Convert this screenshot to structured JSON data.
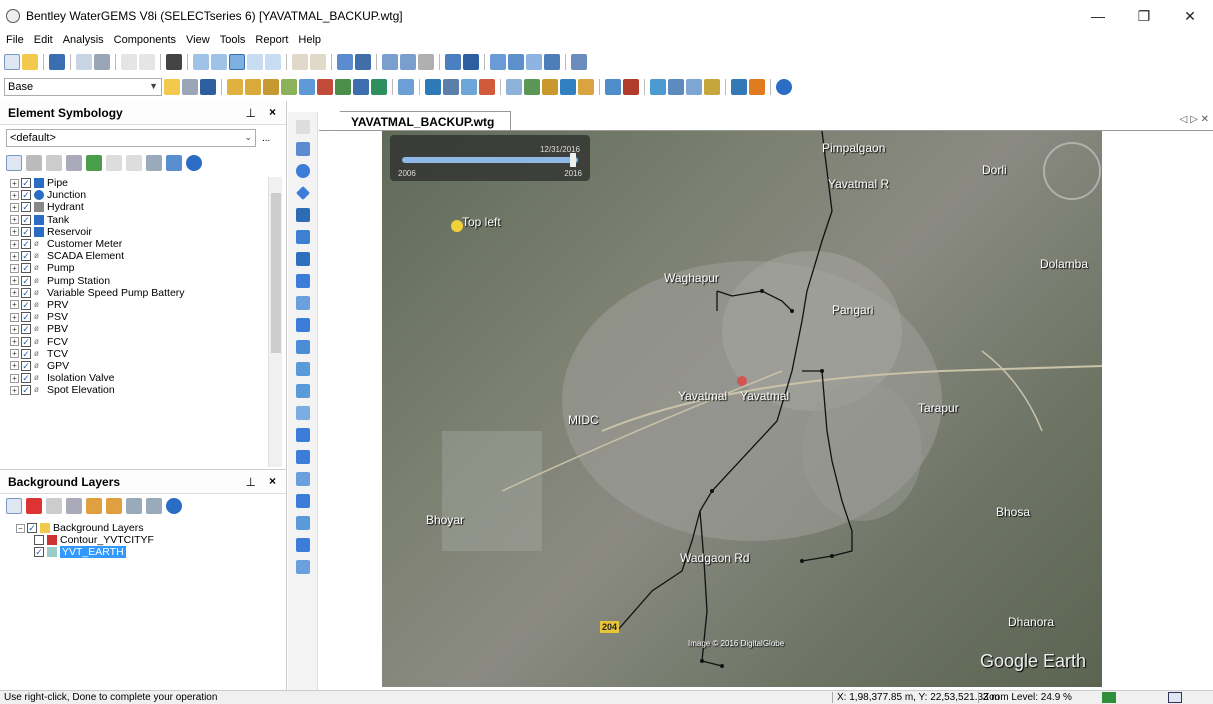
{
  "window": {
    "title": "Bentley WaterGEMS V8i (SELECTseries 6) [YAVATMAL_BACKUP.wtg]"
  },
  "menu": [
    "File",
    "Edit",
    "Analysis",
    "Components",
    "View",
    "Tools",
    "Report",
    "Help"
  ],
  "scenario_combo": {
    "value": "Base"
  },
  "element_symbology": {
    "title": "Element Symbology",
    "pin": "2",
    "close": "×",
    "dropdown_value": "<default>",
    "items": [
      {
        "label": "Pipe",
        "checked": true
      },
      {
        "label": "Junction",
        "checked": true
      },
      {
        "label": "Hydrant",
        "checked": true
      },
      {
        "label": "Tank",
        "checked": true
      },
      {
        "label": "Reservoir",
        "checked": true
      },
      {
        "label": "Customer Meter",
        "checked": true
      },
      {
        "label": "SCADA Element",
        "checked": true
      },
      {
        "label": "Pump",
        "checked": true
      },
      {
        "label": "Pump Station",
        "checked": true
      },
      {
        "label": "Variable Speed Pump Battery",
        "checked": true
      },
      {
        "label": "PRV",
        "checked": true
      },
      {
        "label": "PSV",
        "checked": true
      },
      {
        "label": "PBV",
        "checked": true
      },
      {
        "label": "FCV",
        "checked": true
      },
      {
        "label": "TCV",
        "checked": true
      },
      {
        "label": "GPV",
        "checked": true
      },
      {
        "label": "Isolation Valve",
        "checked": true
      },
      {
        "label": "Spot Elevation",
        "checked": true
      }
    ]
  },
  "background_layers": {
    "title": "Background Layers",
    "close": "×",
    "root": "Background Layers",
    "children": [
      {
        "label": "Contour_YVTCITYF",
        "checked": false
      },
      {
        "label": "YVT_EARTH",
        "checked": true,
        "selected": true
      }
    ]
  },
  "document_tab": {
    "label": "YAVATMAL_BACKUP.wtg"
  },
  "map": {
    "timeline": {
      "start": "2006",
      "end": "2016",
      "date": "12/31/2016"
    },
    "labels": [
      "Pimpalgaon",
      "Dorli",
      "Yavatmal R",
      "Top left",
      "Dolamba",
      "Waghapur",
      "Pangari",
      "Yavatmal",
      "Yavatmal",
      "MIDC",
      "Tarapur",
      "Bhoyar",
      "Bhosa",
      "Wadgaon Rd",
      "Dhanora",
      "Google Earth",
      "Image © 2016 DigitalGlobe",
      "204"
    ]
  },
  "status": {
    "message": "Use right-click, Done to complete your operation",
    "coordinates": "X: 1,98,377.85 m, Y: 22,53,521.33 m",
    "zoom": "Zoom Level: 24.9 %"
  }
}
